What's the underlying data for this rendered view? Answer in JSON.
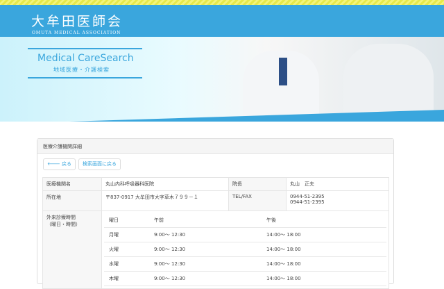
{
  "header": {
    "logo_jp": "大牟田医師会",
    "logo_en": "OMUTA MEDICAL ASSOCIATION"
  },
  "banner": {
    "title": "Medical CareSearch",
    "subtitle": "地域医療・介護検索"
  },
  "panel": {
    "title": "医療介護機関詳細",
    "back_label": "戻る",
    "search_back_label": "検索画面に戻る"
  },
  "info": {
    "name_label": "医療機関名",
    "name": "丸山内科呼吸器科医院",
    "director_label": "院長",
    "director": "丸山　正夫",
    "address_label": "所在地",
    "address": "〒837-0917 大牟田市大字草木７９９－１",
    "tel_label": "TEL/FAX",
    "tel": "0944-51-2395",
    "fax": "0944-51-2395",
    "hours_label": "外来診療時間",
    "hours_sub": "（曜日・時間）"
  },
  "hours": {
    "headers": [
      "曜日",
      "午前",
      "午後"
    ],
    "rows": [
      [
        "月曜",
        "9:00～ 12:30",
        "14:00～ 18:00"
      ],
      [
        "火曜",
        "9:00～ 12:30",
        "14:00～ 18:00"
      ],
      [
        "水曜",
        "9:00～ 12:30",
        "14:00～ 18:00"
      ],
      [
        "木曜",
        "9:00～ 12:30",
        "14:00～ 18:00"
      ]
    ]
  }
}
